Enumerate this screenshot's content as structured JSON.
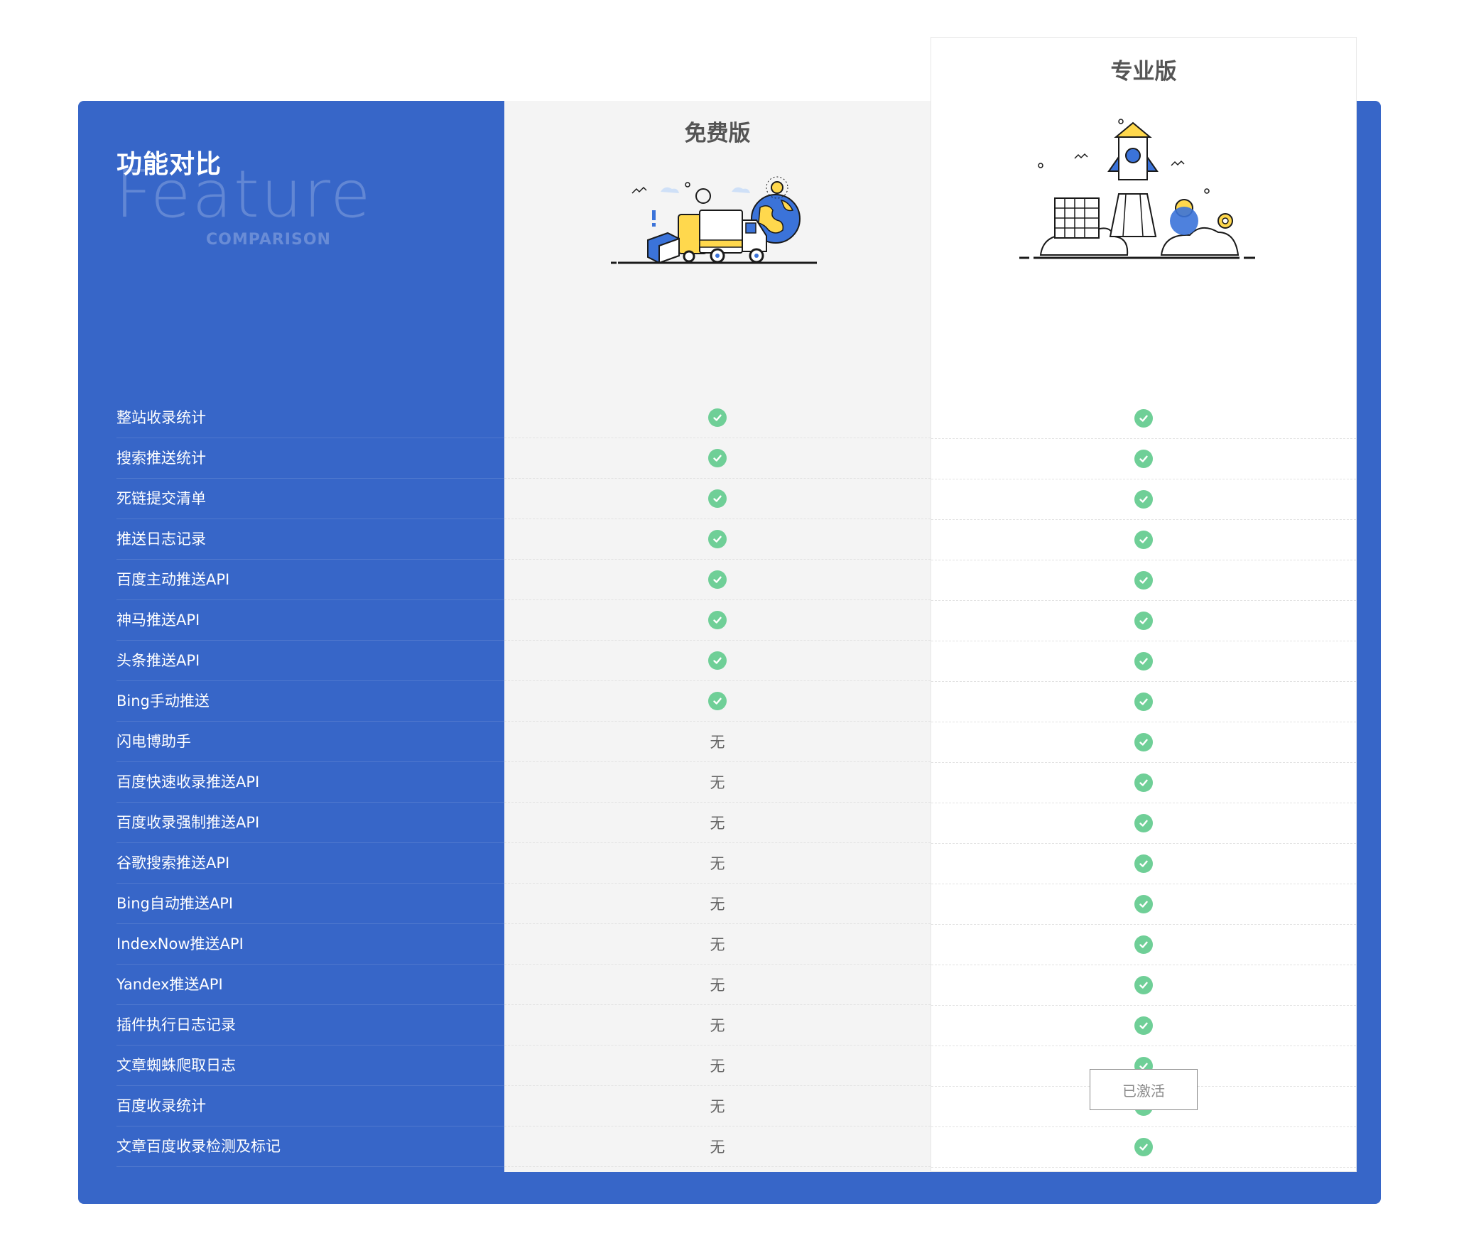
{
  "panel": {
    "title": "功能对比",
    "watermark_big": "Feature",
    "watermark_small": "COMPARISON"
  },
  "plans": {
    "free": {
      "name": "免费版"
    },
    "pro": {
      "name": "专业版",
      "button_label": "已激活"
    }
  },
  "none_label": "无",
  "colors": {
    "panel_blue": "#3766c8",
    "check_green": "#6fcf97",
    "free_bg": "#f4f4f4"
  },
  "features": [
    {
      "label": "整站收录统计",
      "free": true,
      "pro": true
    },
    {
      "label": "搜索推送统计",
      "free": true,
      "pro": true
    },
    {
      "label": "死链提交清单",
      "free": true,
      "pro": true
    },
    {
      "label": "推送日志记录",
      "free": true,
      "pro": true
    },
    {
      "label": "百度主动推送API",
      "free": true,
      "pro": true
    },
    {
      "label": "神马推送API",
      "free": true,
      "pro": true
    },
    {
      "label": "头条推送API",
      "free": true,
      "pro": true
    },
    {
      "label": "Bing手动推送",
      "free": true,
      "pro": true
    },
    {
      "label": "闪电博助手",
      "free": false,
      "pro": true
    },
    {
      "label": "百度快速收录推送API",
      "free": false,
      "pro": true
    },
    {
      "label": "百度收录强制推送API",
      "free": false,
      "pro": true
    },
    {
      "label": "谷歌搜索推送API",
      "free": false,
      "pro": true
    },
    {
      "label": "Bing自动推送API",
      "free": false,
      "pro": true
    },
    {
      "label": "IndexNow推送API",
      "free": false,
      "pro": true
    },
    {
      "label": "Yandex推送API",
      "free": false,
      "pro": true
    },
    {
      "label": "插件执行日志记录",
      "free": false,
      "pro": true
    },
    {
      "label": "文章蜘蛛爬取日志",
      "free": false,
      "pro": true
    },
    {
      "label": "百度收录统计",
      "free": false,
      "pro": true
    },
    {
      "label": "文章百度收录检测及标记",
      "free": false,
      "pro": true
    }
  ]
}
